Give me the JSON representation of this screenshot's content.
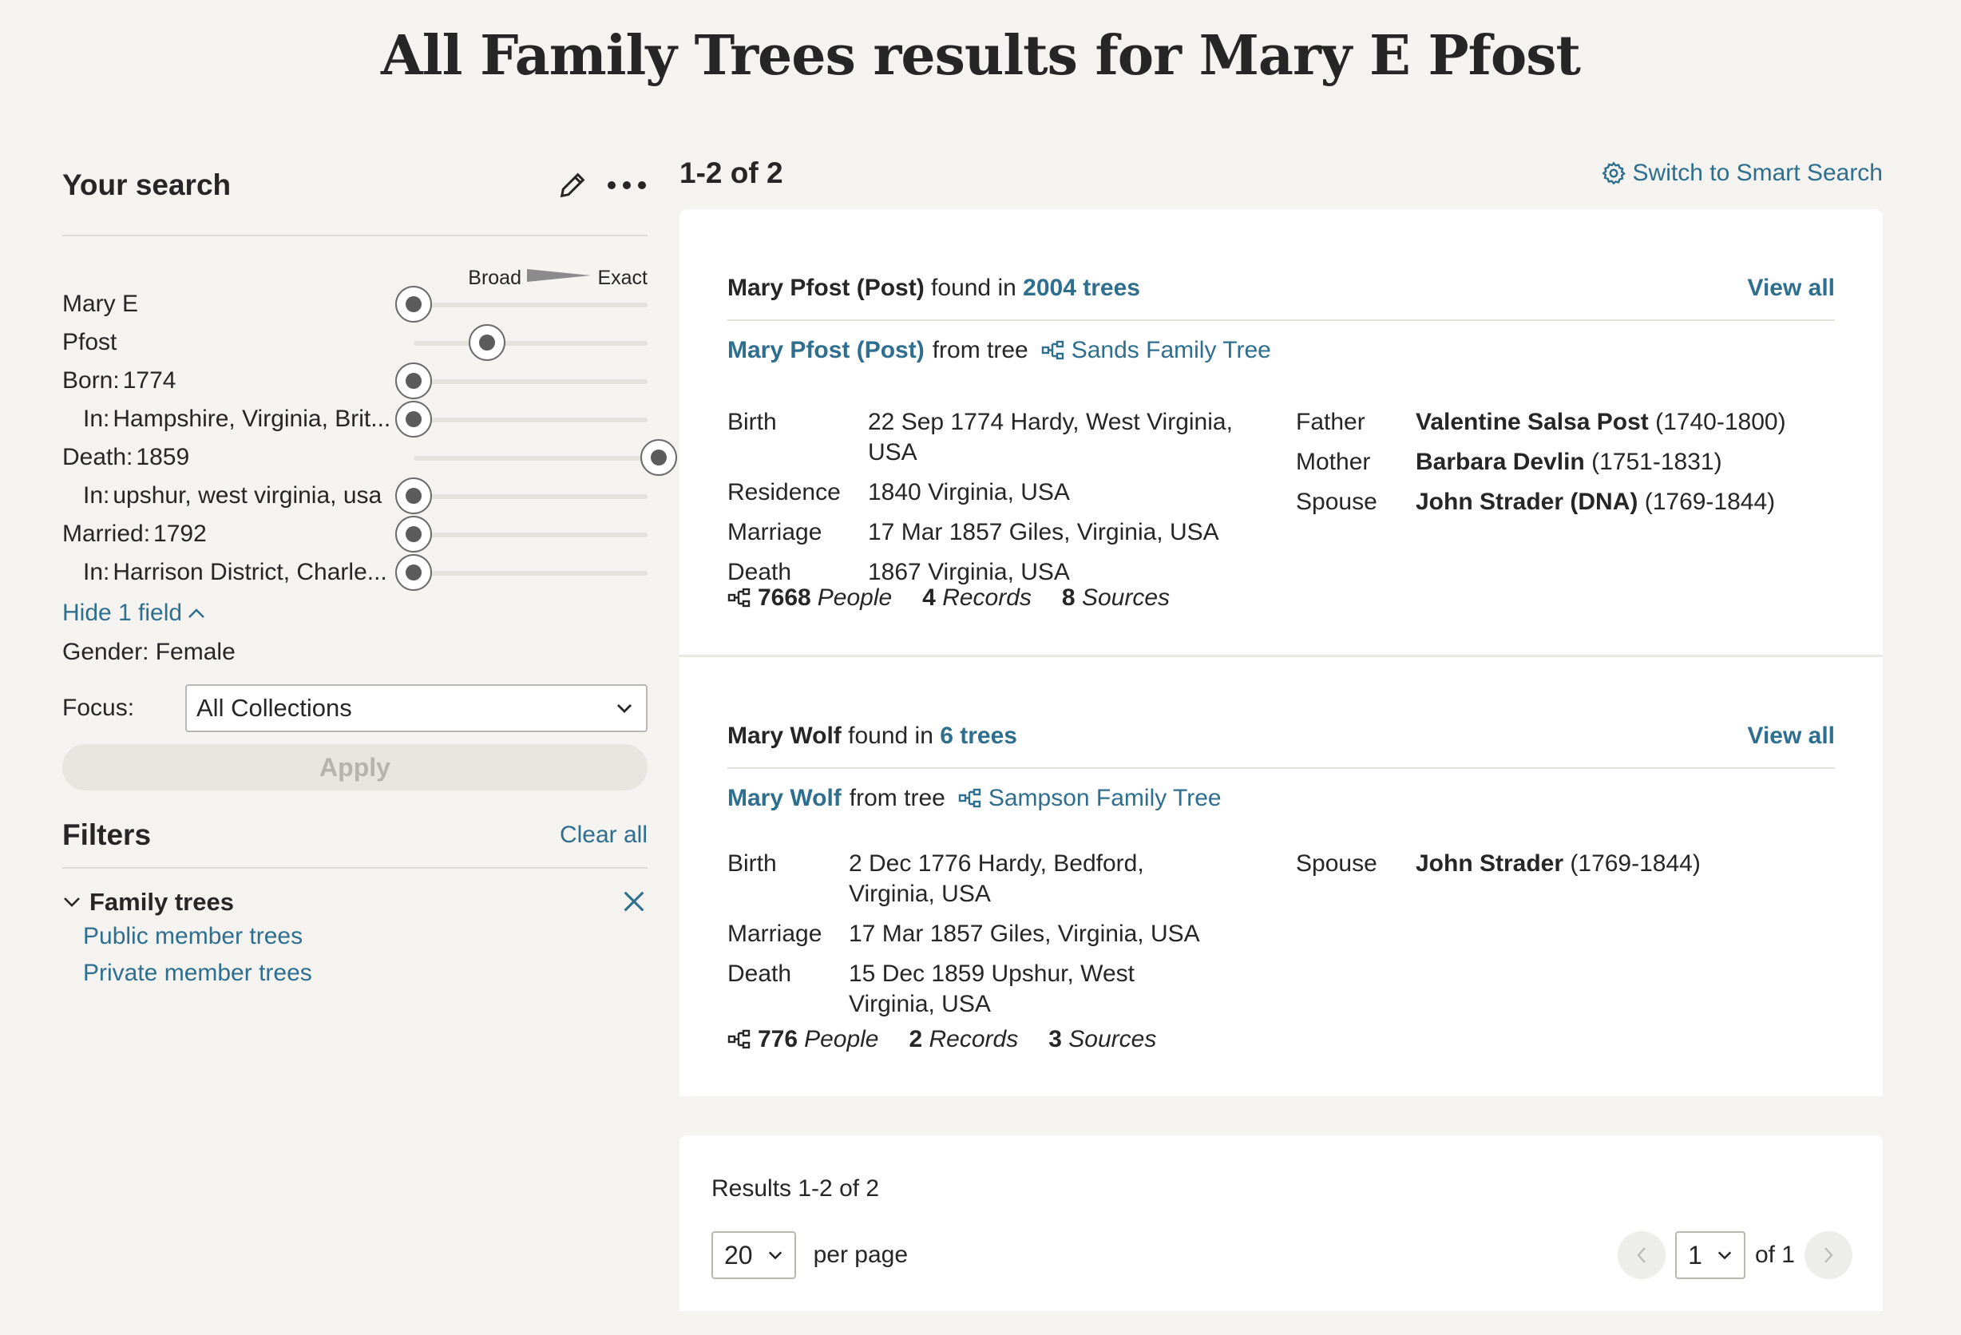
{
  "page": {
    "title": "All Family Trees results for Mary E Pfost"
  },
  "search": {
    "title": "Your search",
    "scale": {
      "broad": "Broad",
      "exact": "Exact"
    },
    "fields": [
      {
        "key": "",
        "value": "Mary E",
        "indent": false,
        "position": 0
      },
      {
        "key": "",
        "value": "Pfost",
        "indent": false,
        "position": 0.3
      },
      {
        "key": "Born:",
        "value": "1774",
        "indent": false,
        "position": 0
      },
      {
        "key": "In:",
        "value": "Hampshire, Virginia, Brit...",
        "indent": true,
        "position": 0
      },
      {
        "key": "Death:",
        "value": "1859",
        "indent": false,
        "position": 1
      },
      {
        "key": "In:",
        "value": "upshur, west virginia, usa",
        "indent": true,
        "position": 0
      },
      {
        "key": "Married:",
        "value": "1792",
        "indent": false,
        "position": 0
      },
      {
        "key": "In:",
        "value": "Harrison District, Charle...",
        "indent": true,
        "position": 0
      }
    ],
    "hide_fields": "Hide 1 field",
    "gender": "Gender: Female",
    "focus_label": "Focus:",
    "focus_value": "All Collections",
    "apply": "Apply"
  },
  "filters": {
    "title": "Filters",
    "clear_all": "Clear all",
    "group": "Family trees",
    "options": [
      "Public member trees",
      "Private member trees"
    ]
  },
  "results": {
    "count": "1-2 of 2",
    "smart_search": "Switch to Smart Search",
    "found_in": "found in",
    "view_all": "View all",
    "from_tree": "from tree",
    "items": [
      {
        "name": "Mary Pfost (Post)",
        "trees": "2004 trees",
        "tree_name": "Sands Family Tree",
        "facts": [
          {
            "k": "Birth",
            "v": "22 Sep 1774 Hardy, West Virginia, USA"
          },
          {
            "k": "Residence",
            "v": "1840 Virginia, USA"
          },
          {
            "k": "Marriage",
            "v": "17 Mar 1857 Giles, Virginia, USA"
          },
          {
            "k": "Death",
            "v": "1867 Virginia, USA"
          }
        ],
        "relations": [
          {
            "k": "Father",
            "name": "Valentine Salsa Post",
            "years": "(1740-1800)"
          },
          {
            "k": "Mother",
            "name": "Barbara Devlin",
            "years": "(1751-1831)"
          },
          {
            "k": "Spouse",
            "name": "John Strader (DNA)",
            "years": "(1769-1844)"
          }
        ],
        "people": "7668",
        "records": "4",
        "sources": "8"
      },
      {
        "name": "Mary Wolf",
        "trees": "6 trees",
        "tree_name": "Sampson Family Tree",
        "facts": [
          {
            "k": "Birth",
            "v": "2 Dec 1776 Hardy, Bedford, Virginia, USA"
          },
          {
            "k": "Marriage",
            "v": "17 Mar 1857 Giles, Virginia, USA"
          },
          {
            "k": "Death",
            "v": "15 Dec 1859 Upshur, West Virginia, USA"
          }
        ],
        "relations": [
          {
            "k": "Spouse",
            "name": "John Strader",
            "years": "(1769-1844)"
          }
        ],
        "people": "776",
        "records": "2",
        "sources": "3"
      }
    ],
    "labels": {
      "people": "People",
      "records": "Records",
      "sources": "Sources"
    }
  },
  "pager": {
    "total": "Results 1-2 of 2",
    "per_page_value": "20",
    "per_page_label": "per page",
    "page_value": "1",
    "of_pages": "of 1"
  },
  "colors": {
    "link": "#2e6e8e",
    "background": "#f4f3ef"
  }
}
